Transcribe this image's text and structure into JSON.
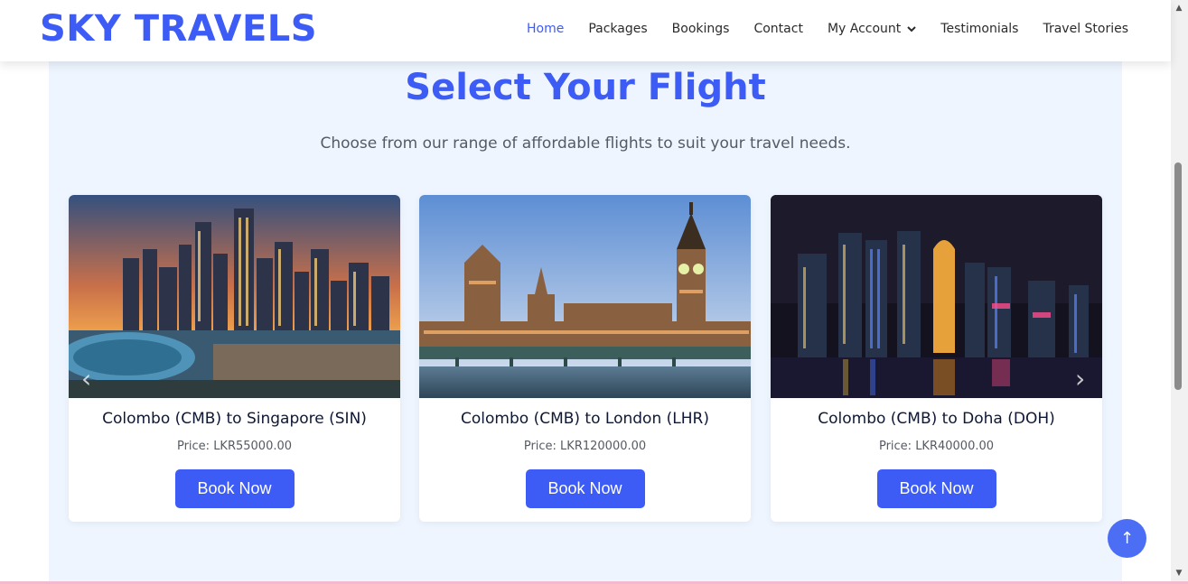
{
  "brand": {
    "name": "SKY TRAVELS"
  },
  "nav": {
    "items": [
      {
        "label": "Home"
      },
      {
        "label": "Packages"
      },
      {
        "label": "Bookings"
      },
      {
        "label": "Contact"
      },
      {
        "label": "My Account"
      },
      {
        "label": "Testimonials"
      },
      {
        "label": "Travel Stories"
      }
    ]
  },
  "section": {
    "title": "Select Your Flight",
    "subtitle": "Choose from our range of affordable flights to suit your travel needs."
  },
  "flights": [
    {
      "route": "Colombo (CMB) to Singapore (SIN)",
      "price": "Price: LKR55000.00",
      "button": "Book Now",
      "image": "singapore-skyline"
    },
    {
      "route": "Colombo (CMB) to London (LHR)",
      "price": "Price: LKR120000.00",
      "button": "Book Now",
      "image": "london-parliament"
    },
    {
      "route": "Colombo (CMB) to Doha (DOH)",
      "price": "Price: LKR40000.00",
      "button": "Book Now",
      "image": "doha-night-skyline"
    }
  ],
  "icons": {
    "carousel_prev": "‹",
    "carousel_next": "›",
    "back_to_top": "↑",
    "dropdown": "⌄"
  },
  "colors": {
    "accent": "#3d5bf5",
    "section_bg": "#eef5ff"
  }
}
